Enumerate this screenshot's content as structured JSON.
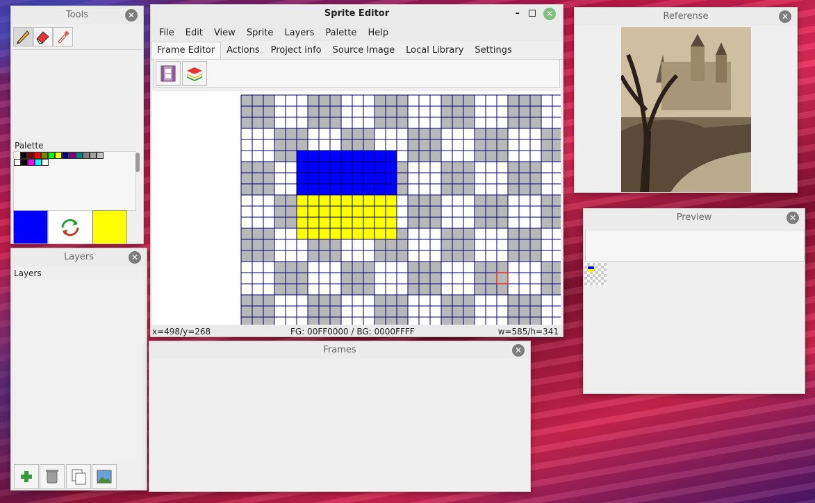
{
  "tools": {
    "title": "Tools",
    "palette_label": "Palette",
    "row1_colors": [
      "#000000",
      "#800000",
      "#ff0000",
      "#808000",
      "#00ff00",
      "#ffff00",
      "#000080",
      "#800080",
      "#008080",
      "#808080",
      "#a0a0a0",
      "#c0c0c0"
    ],
    "row2_colors": [
      "#ffffff",
      "#000000",
      "#ff00ff",
      "#00ffff",
      "#ffffff"
    ],
    "fg_color": "#0000ff",
    "bg_color": "#ffff00"
  },
  "layers": {
    "title": "Layers",
    "label": "Layers"
  },
  "editor": {
    "title": "Sprite Editor",
    "menu": [
      "File",
      "Edit",
      "View",
      "Sprite",
      "Layers",
      "Palette",
      "Help"
    ],
    "tabs": [
      "Frame Editor",
      "Actions",
      "Project info",
      "Source Image",
      "Local Library",
      "Settings"
    ],
    "active_tab": 0,
    "status": {
      "coords": "x=498/y=268",
      "colors": "FG: 00FF0000 / BG: 0000FFFF",
      "size": "w=585/h=341"
    },
    "canvas": {
      "blue": "#0000ff",
      "yellow": "#ffff00",
      "checker_gray": "#b8b8b8",
      "grid_line": "#00006e"
    }
  },
  "reference": {
    "title": "Referense"
  },
  "preview": {
    "title": "Preview"
  },
  "frames": {
    "title": "Frames"
  }
}
